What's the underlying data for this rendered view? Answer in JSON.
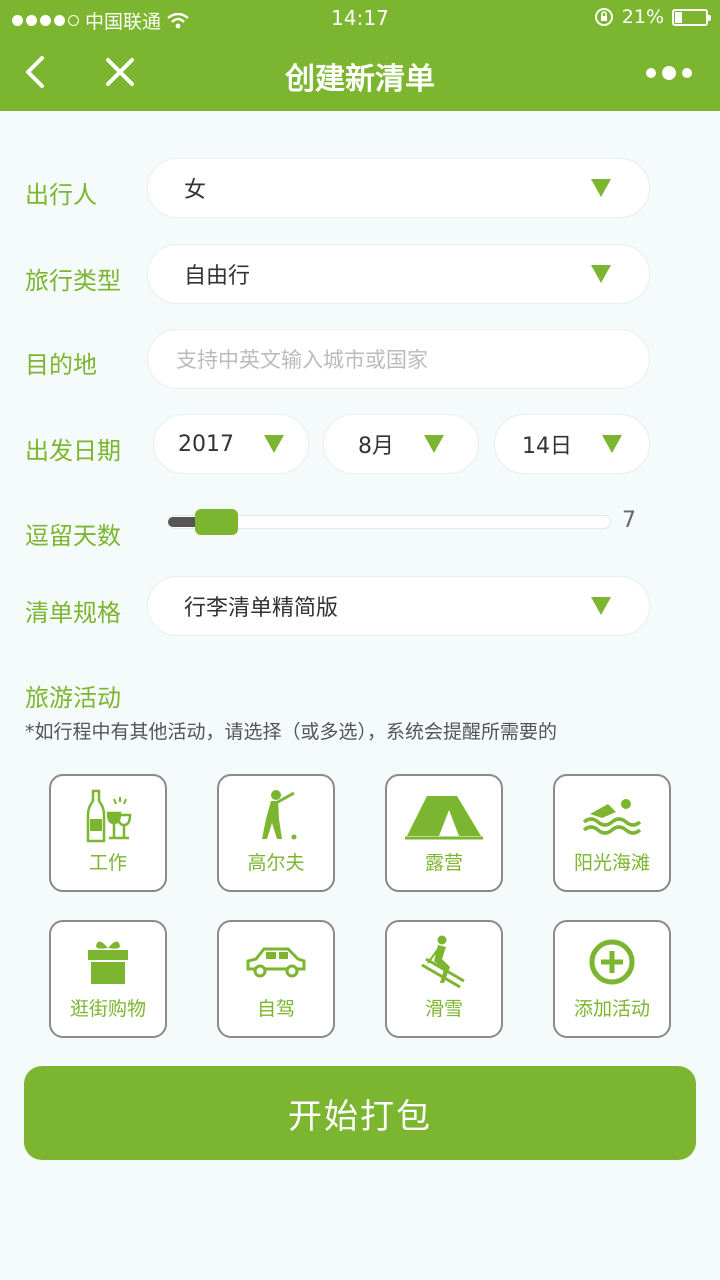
{
  "status_bar": {
    "carrier": "中国联通",
    "time": "14:17",
    "battery": "21%",
    "battery_level": 0.21
  },
  "nav": {
    "title": "创建新清单"
  },
  "form": {
    "traveler_label": "出行人",
    "traveler_value": "女",
    "trip_type_label": "旅行类型",
    "trip_type_value": "自由行",
    "destination_label": "目的地",
    "destination_placeholder": "支持中英文输入城市或国家",
    "date_label": "出发日期",
    "year": "2017",
    "month": "8月",
    "day": "14日",
    "stay_label": "逗留天数",
    "stay_days": "7",
    "list_spec_label": "清单规格",
    "list_spec_value": "行李清单精简版"
  },
  "activities": {
    "title": "旅游活动",
    "note": "*如行程中有其他活动，请选择（或多选），系统会提醒所需要的",
    "items": [
      {
        "label": "工作",
        "icon": "wine-glasses-icon"
      },
      {
        "label": "高尔夫",
        "icon": "golfer-icon"
      },
      {
        "label": "露营",
        "icon": "tent-icon"
      },
      {
        "label": "阳光海滩",
        "icon": "swimmer-icon"
      },
      {
        "label": "逛街购物",
        "icon": "gift-icon"
      },
      {
        "label": "自驾",
        "icon": "car-icon"
      },
      {
        "label": "滑雪",
        "icon": "skier-icon"
      },
      {
        "label": "添加活动",
        "icon": "add-circle-icon"
      }
    ]
  },
  "start_button": "开始打包",
  "colors": {
    "accent": "#7cb52f",
    "background": "#f5fafb"
  }
}
